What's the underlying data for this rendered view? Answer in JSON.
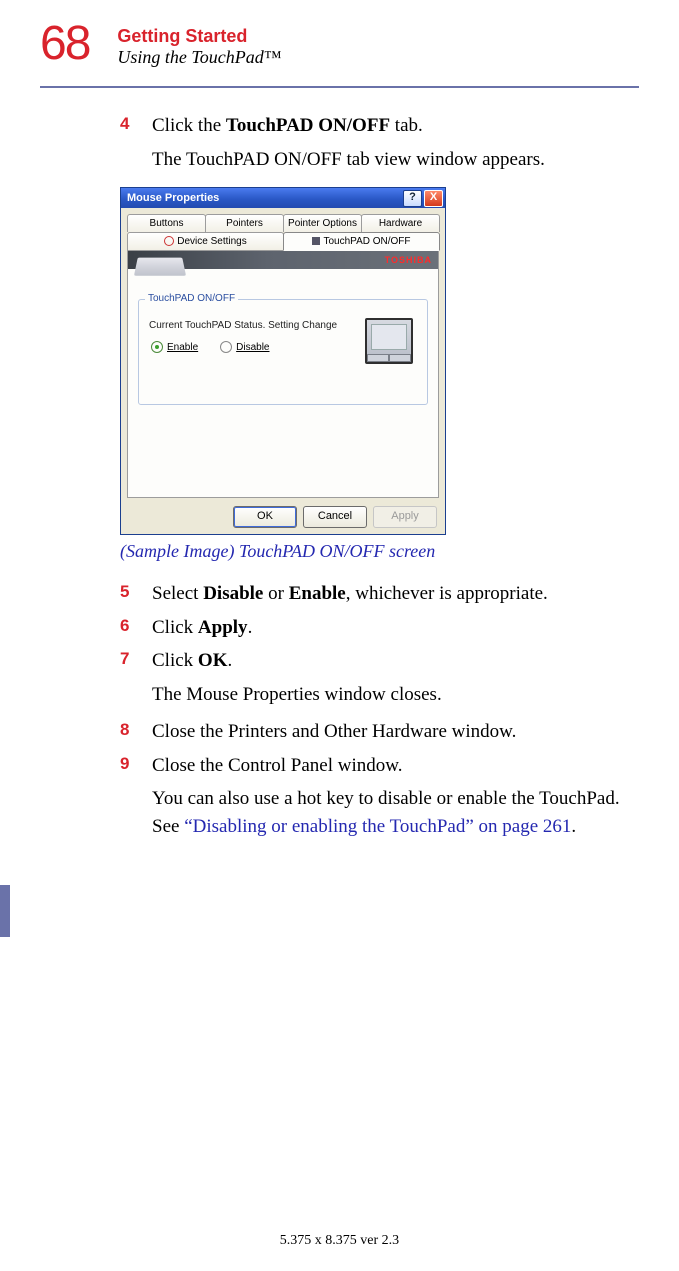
{
  "header": {
    "page_number": "68",
    "chapter": "Getting Started",
    "section": "Using the TouchPad™"
  },
  "dialog": {
    "title": "Mouse Properties",
    "help_btn": "?",
    "close_btn": "X",
    "tabs_row1": [
      "Buttons",
      "Pointers",
      "Pointer Options",
      "Hardware"
    ],
    "tabs_row2": [
      "Device Settings",
      "TouchPAD ON/OFF"
    ],
    "active_tab": "TouchPAD ON/OFF",
    "brand": "TOSHIBA",
    "group_title": "TouchPAD ON/OFF",
    "status_text": "Current TouchPAD Status. Setting Change",
    "radio_enable": "Enable",
    "radio_disable": "Disable",
    "btn_ok": "OK",
    "btn_cancel": "Cancel",
    "btn_apply": "Apply"
  },
  "caption": "(Sample Image) TouchPAD ON/OFF screen",
  "steps": {
    "s4": {
      "num": "4",
      "pre": "Click the ",
      "bold": "TouchPAD ON/OFF",
      "post": " tab."
    },
    "s4_follow": "The TouchPAD ON/OFF tab view window appears.",
    "s5": {
      "num": "5",
      "pre": "Select ",
      "b1": "Disable",
      "mid": " or ",
      "b2": "Enable",
      "post": ", whichever is appropriate."
    },
    "s6": {
      "num": "6",
      "pre": "Click ",
      "bold": "Apply",
      "post": "."
    },
    "s7": {
      "num": "7",
      "pre": "Click ",
      "bold": "OK",
      "post": "."
    },
    "s7_follow": "The Mouse Properties window closes.",
    "s8": {
      "num": "8",
      "text": "Close the Printers and Other Hardware window."
    },
    "s9": {
      "num": "9",
      "text": "Close the Control Panel window."
    },
    "s9_follow_pre": "You can also use a hot key to disable or enable the TouchPad. See ",
    "s9_link": "“Disabling or enabling the TouchPad” on page 261",
    "s9_follow_post": "."
  },
  "footer": "5.375 x 8.375 ver 2.3"
}
